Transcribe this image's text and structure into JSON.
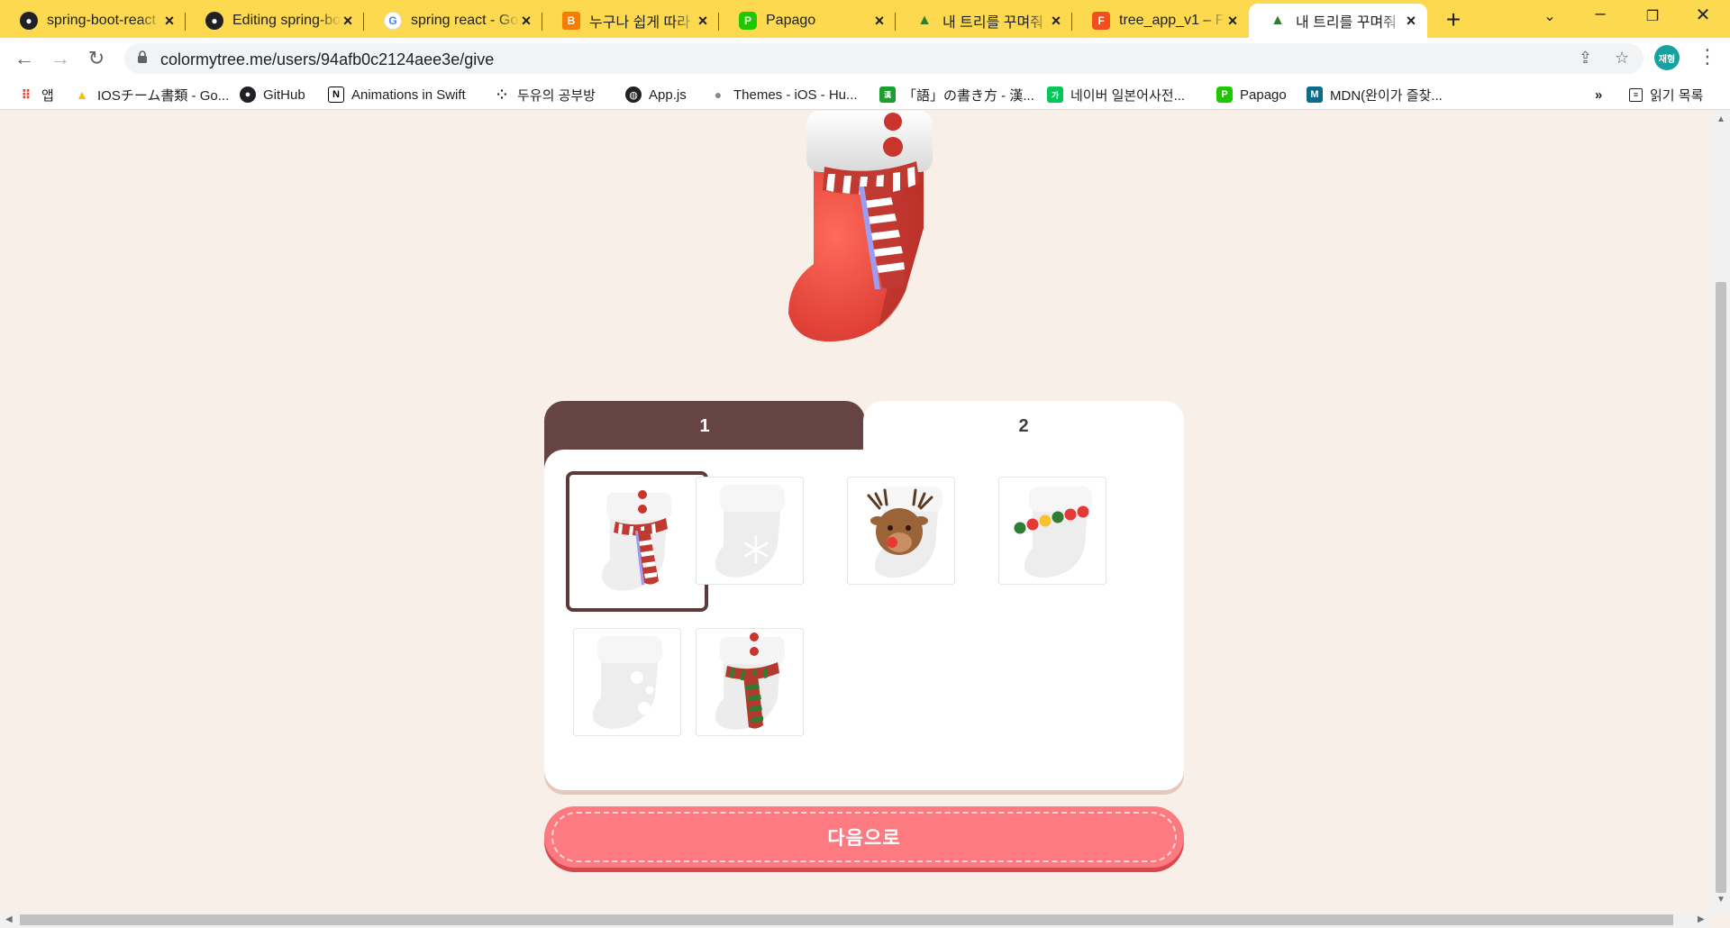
{
  "browser": {
    "tabs": [
      {
        "title": "spring-boot-react",
        "icon": "github-icon",
        "color": "#202124"
      },
      {
        "title": "Editing spring-bo",
        "icon": "github-icon",
        "color": "#202124"
      },
      {
        "title": "spring react - Go",
        "icon": "google-icon",
        "color": "#4285f4"
      },
      {
        "title": "누구나 쉽게 따라",
        "icon": "blogger-icon",
        "color": "#f57d00"
      },
      {
        "title": "Papago",
        "icon": "papago-icon",
        "color": "#1ec800"
      },
      {
        "title": "내 트리를 꾸며줘",
        "icon": "tree-icon",
        "color": "#2e7d32"
      },
      {
        "title": "tree_app_v1 – Fig",
        "icon": "figma-icon",
        "color": "#f24e1e"
      },
      {
        "title": "내 트리를 꾸며줘",
        "icon": "tree-icon",
        "color": "#2e7d32",
        "active": true
      }
    ],
    "url": "colormytree.me/users/94afb0c2124aee3e/give",
    "profile_initials": "재형",
    "bookmarks": [
      {
        "label": "앱",
        "icon": "apps-grid-icon"
      },
      {
        "label": "IOSチーム書類 - Go...",
        "icon": "google-drive-icon"
      },
      {
        "label": "GitHub",
        "icon": "github-icon"
      },
      {
        "label": "Animations in Swift",
        "icon": "notion-icon"
      },
      {
        "label": "두유의 공부방",
        "icon": "dots-icon"
      },
      {
        "label": "App.js",
        "icon": "globe-icon"
      },
      {
        "label": "Themes - iOS - Hu...",
        "icon": "apple-icon"
      },
      {
        "label": "「語」の書き方 - 漢...",
        "icon": "kanji-icon"
      },
      {
        "label": "네이버 일본어사전...",
        "icon": "naver-dict-icon"
      },
      {
        "label": "Papago",
        "icon": "papago-icon"
      },
      {
        "label": "MDN(완이가 즐찾...",
        "icon": "mdn-icon"
      }
    ],
    "bookmarks_overflow": "»",
    "reading_list": "읽기 목록"
  },
  "page": {
    "tabs": [
      {
        "label": "1",
        "active": true
      },
      {
        "label": "2",
        "active": false
      }
    ],
    "items": [
      {
        "name": "stocking-striped-scarf",
        "selected": true
      },
      {
        "name": "stocking-snowflake",
        "selected": false
      },
      {
        "name": "stocking-reindeer",
        "selected": false
      },
      {
        "name": "stocking-beads",
        "selected": false
      },
      {
        "name": "stocking-polka-dots",
        "selected": false
      },
      {
        "name": "stocking-green-scarf",
        "selected": false
      }
    ],
    "next_button": "다음으로",
    "colors": {
      "background": "#f7efe8",
      "tab_active": "#654443",
      "button": "#fc7a80",
      "selected_border": "#5c3a3a"
    }
  }
}
